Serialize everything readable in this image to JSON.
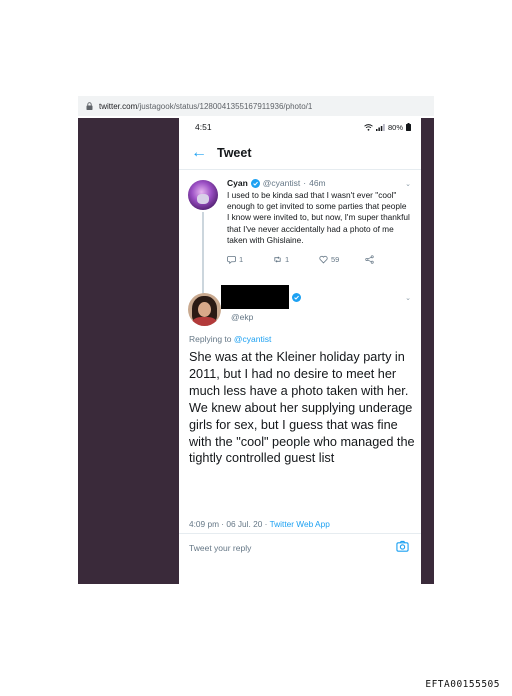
{
  "browser": {
    "url_host": "twitter.com",
    "url_path": "/justagook/status/1280041355167911936/photo/1"
  },
  "statusbar": {
    "time": "4:51",
    "battery": "80%"
  },
  "header": {
    "back_icon": "arrow-left-icon",
    "title": "Tweet"
  },
  "parent_tweet": {
    "name": "Cyan",
    "handle": "@cyantist",
    "separator": "·",
    "time": "46m",
    "text": "I used to be kinda sad that I wasn't ever \"cool\" enough to get invited to some parties that people I know were invited to, but now, I'm super thankful that I've never accidentally had a photo of me taken with Ghislaine.",
    "replies": "1",
    "retweets": "1",
    "likes": "59"
  },
  "focal_tweet": {
    "handle": "@ekp",
    "replying_prefix": "Replying to",
    "replying_to": "@cyantist",
    "text": "She was at the Kleiner holiday party in 2011, but I had no desire to meet her much less have a photo taken with her. We knew about her supplying underage girls for sex, but I guess that was fine with the \"cool\" people who managed the tightly controlled guest list",
    "time": "4:09 pm · 06 Jul. 20 ·",
    "source": "Twitter Web App",
    "reply_placeholder": "Tweet your reply"
  },
  "accent_color": "#1da1f2",
  "document_id": "EFTA00155505"
}
